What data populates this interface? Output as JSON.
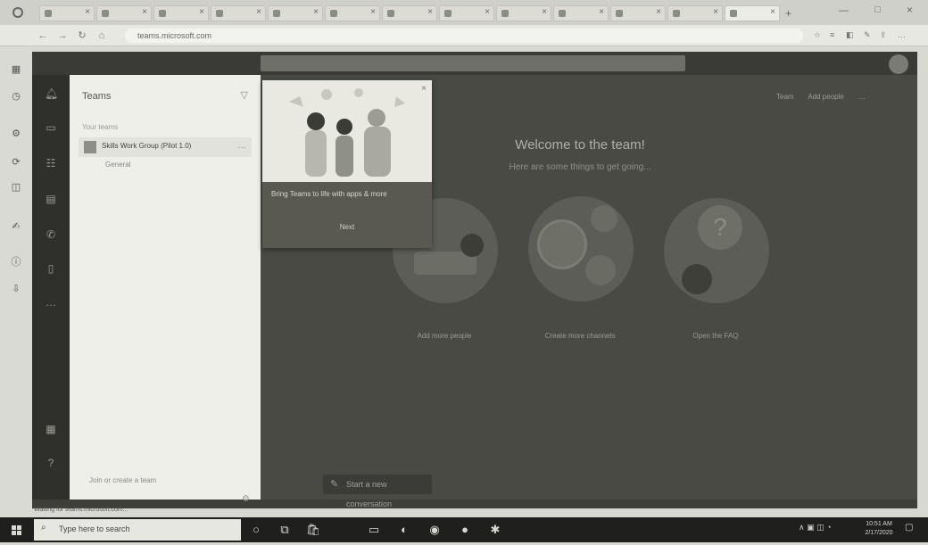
{
  "browser": {
    "tabs": [
      "Microsoft Teams",
      "",
      "",
      "",
      "",
      "",
      "",
      "",
      "",
      "",
      "",
      "",
      "",
      ""
    ],
    "url": "teams.microsoft.com"
  },
  "teams": {
    "panel_title": "Teams",
    "section_label": "Your teams",
    "team_name": "Skills Work Group (Pilot 1.0)",
    "channel": "General",
    "join_create": "Join or create a team",
    "welcome_title": "Welcome to the team!",
    "welcome_subtitle": "Here are some things to get going...",
    "top_links": [
      "Team",
      "Add people"
    ],
    "actions": [
      {
        "label": "Add more people"
      },
      {
        "label": "Create more channels"
      },
      {
        "label": "Open the FAQ"
      }
    ],
    "bottom_button": "Start a new conversation"
  },
  "popup": {
    "text": "Bring Teams to life with apps & more",
    "next": "Next"
  },
  "status": "Waiting for teams.microsoft.com...",
  "taskbar": {
    "search_placeholder": "Type here to search",
    "time": "10:51 AM",
    "date": "2/17/2020"
  },
  "colors": {
    "app_rail": "#2f302c",
    "main_bg": "#494a44",
    "panel_bg": "#efefea",
    "taskbar": "#1f201d"
  }
}
